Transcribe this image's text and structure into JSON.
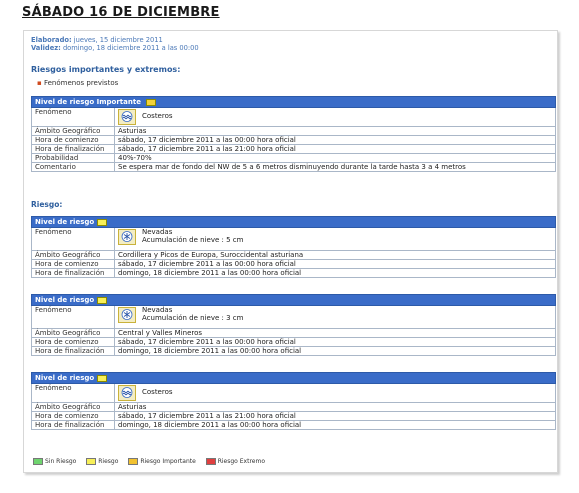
{
  "page_title": "SÁBADO 16 DE DICIEMBRE",
  "elaborado": {
    "key": "Elaborado:",
    "value": "jueves, 15 diciembre 2011"
  },
  "validez": {
    "key": "Validez:",
    "value": "domingo, 18 diciembre 2011 a las 00:00"
  },
  "section_title": "Riesgos importantes y extremos:",
  "bullet": "Fenómenos previstos",
  "riesgo_label": "Riesgo:",
  "colors": {
    "header_blue": "#3a6cc8",
    "important_yellow": "#f2d23a",
    "risk_yellow": "#f7ef58"
  },
  "important_table": {
    "header": "Nivel de riesgo Importante",
    "rows": [
      {
        "label": "Fenómeno",
        "value": "Costeros",
        "icon": "waves-icon"
      },
      {
        "label": "Ámbito Geográfico",
        "value": "Asturias"
      },
      {
        "label": "Hora de comienzo",
        "value": "sábado, 17 diciembre 2011 a las 00:00 hora oficial"
      },
      {
        "label": "Hora de finalización",
        "value": "sábado, 17 diciembre 2011 a las 21:00 hora oficial"
      },
      {
        "label": "Probabilidad",
        "value": "40%-70%"
      },
      {
        "label": "Comentario",
        "value": "Se espera mar de fondo del NW de 5 a 6 metros disminuyendo durante la tarde hasta 3 a 4 metros"
      }
    ]
  },
  "risk_tables": [
    {
      "header": "Nivel de riesgo",
      "fenomeno_label": "Fenómeno",
      "fenomeno": "Nevadas",
      "extra": "Acumulación de nieve : 5 cm",
      "icon": "snowflake-icon",
      "rows": [
        {
          "label": "Ámbito Geográfico",
          "value": "Cordillera y Picos de Europa, Suroccidental asturiana"
        },
        {
          "label": "Hora de comienzo",
          "value": "sábado, 17 diciembre 2011 a las 00:00 hora oficial"
        },
        {
          "label": "Hora de finalización",
          "value": "domingo, 18 diciembre 2011 a las 00:00 hora oficial"
        }
      ]
    },
    {
      "header": "Nivel de riesgo",
      "fenomeno_label": "Fenómeno",
      "fenomeno": "Nevadas",
      "extra": "Acumulación de nieve : 3 cm",
      "icon": "snowflake-icon",
      "rows": [
        {
          "label": "Ámbito Geográfico",
          "value": "Central y Valles Mineros"
        },
        {
          "label": "Hora de comienzo",
          "value": "sábado, 17 diciembre 2011 a las 00:00 hora oficial"
        },
        {
          "label": "Hora de finalización",
          "value": "domingo, 18 diciembre 2011 a las 00:00 hora oficial"
        }
      ]
    },
    {
      "header": "Nivel de riesgo",
      "fenomeno_label": "Fenómeno",
      "fenomeno": "Costeros",
      "extra": "",
      "icon": "waves-icon",
      "rows": [
        {
          "label": "Ámbito Geográfico",
          "value": "Asturias"
        },
        {
          "label": "Hora de comienzo",
          "value": "sábado, 17 diciembre 2011 a las 21:00 hora oficial"
        },
        {
          "label": "Hora de finalización",
          "value": "domingo, 18 diciembre 2011 a las 00:00 hora oficial"
        }
      ]
    }
  ],
  "legend": [
    {
      "label": "Sin Riesgo",
      "color": "#6fd46f"
    },
    {
      "label": "Riesgo",
      "color": "#f7ef58"
    },
    {
      "label": "Riesgo Importante",
      "color": "#f2c230"
    },
    {
      "label": "Riesgo Extremo",
      "color": "#e04040"
    }
  ]
}
